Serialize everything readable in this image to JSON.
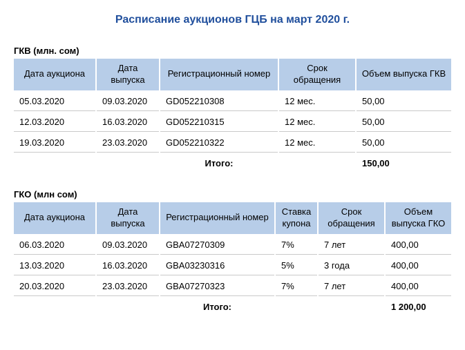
{
  "title": "Расписание аукционов ГЦБ на март 2020 г.",
  "table1": {
    "caption": "ГКВ (млн. сом)",
    "headers": {
      "auction_date": "Дата   аукциона",
      "issue_date": "Дата выпуска",
      "reg_no": "Регистрационный   номер",
      "term": "Срок обращения",
      "volume": "Объем выпуска ГКВ"
    },
    "rows": [
      {
        "auction_date": "05.03.2020",
        "issue_date": "09.03.2020",
        "reg_no": "GD052210308",
        "term": "12 мес.",
        "volume": "50,00"
      },
      {
        "auction_date": "12.03.2020",
        "issue_date": "16.03.2020",
        "reg_no": "GD052210315",
        "term": "12 мес.",
        "volume": "50,00"
      },
      {
        "auction_date": "19.03.2020",
        "issue_date": "23.03.2020",
        "reg_no": "GD052210322",
        "term": "12 мес.",
        "volume": "50,00"
      }
    ],
    "total_label": "Итого:",
    "total_value": "150,00"
  },
  "table2": {
    "caption": "ГКО (млн сом)",
    "headers": {
      "auction_date": "Дата   аукциона",
      "issue_date": "Дата выпуска",
      "reg_no": "Регистрационный   номер",
      "coupon": "Ставка купона",
      "term": "Срок обращения",
      "volume": "Объем выпуска ГКО"
    },
    "rows": [
      {
        "auction_date": "06.03.2020",
        "issue_date": "09.03.2020",
        "reg_no": "GBA07270309",
        "coupon": "7%",
        "term": "7 лет",
        "volume": "400,00"
      },
      {
        "auction_date": "13.03.2020",
        "issue_date": "16.03.2020",
        "reg_no": "GBA03230316",
        "coupon": "5%",
        "term": "3 года",
        "volume": "400,00"
      },
      {
        "auction_date": "20.03.2020",
        "issue_date": "23.03.2020",
        "reg_no": "GBA07270323",
        "coupon": "7%",
        "term": "7 лет",
        "volume": "400,00"
      }
    ],
    "total_label": "Итого:",
    "total_value": "1 200,00"
  }
}
